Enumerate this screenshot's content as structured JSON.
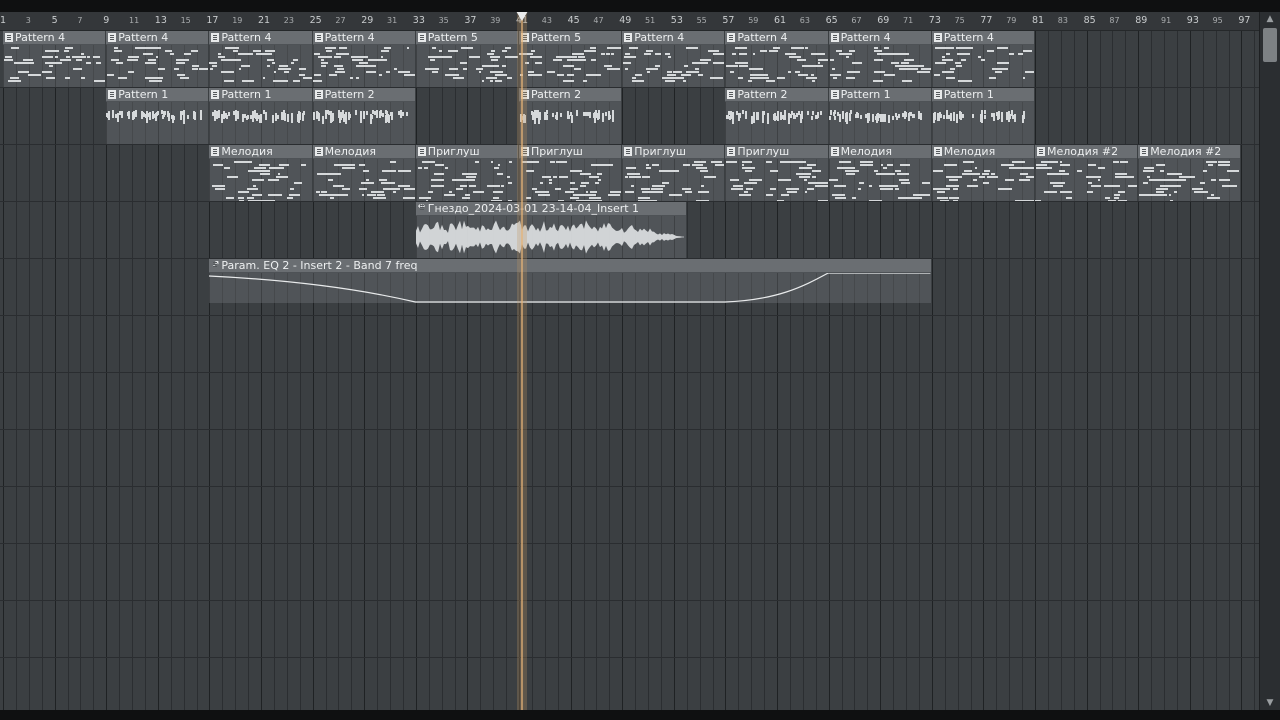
{
  "window": {
    "title": ""
  },
  "ruler": {
    "bars": [
      "1",
      "3",
      "5",
      "7",
      "9",
      "11",
      "13",
      "15",
      "17",
      "19",
      "21",
      "23",
      "25",
      "27",
      "29",
      "31",
      "33",
      "35",
      "37",
      "39",
      "41",
      "43",
      "45",
      "47",
      "49",
      "51",
      "53",
      "55",
      "57",
      "59",
      "61",
      "63",
      "65",
      "67",
      "69",
      "71",
      "73",
      "75",
      "77",
      "79",
      "81",
      "83",
      "85",
      "87",
      "89",
      "91",
      "93",
      "95",
      "97"
    ]
  },
  "playhead": {
    "bar": 41.2
  },
  "tracks": [
    {
      "name": "track-1",
      "clips": [
        {
          "label": "Pattern 4",
          "type": "pattern",
          "start": 1,
          "end": 9
        },
        {
          "label": "Pattern 4",
          "type": "pattern",
          "start": 9,
          "end": 17
        },
        {
          "label": "Pattern 4",
          "type": "pattern",
          "start": 17,
          "end": 25
        },
        {
          "label": "Pattern 4",
          "type": "pattern",
          "start": 25,
          "end": 33
        },
        {
          "label": "Pattern 5",
          "type": "pattern",
          "start": 33,
          "end": 41
        },
        {
          "label": "Pattern 5",
          "type": "pattern",
          "start": 41,
          "end": 49
        },
        {
          "label": "Pattern 4",
          "type": "pattern",
          "start": 49,
          "end": 57
        },
        {
          "label": "Pattern 4",
          "type": "pattern",
          "start": 57,
          "end": 65
        },
        {
          "label": "Pattern 4",
          "type": "pattern",
          "start": 65,
          "end": 73
        },
        {
          "label": "Pattern 4",
          "type": "pattern",
          "start": 73,
          "end": 81
        }
      ]
    },
    {
      "name": "track-2",
      "clips": [
        {
          "label": "Pattern 1",
          "type": "pattern",
          "start": 9,
          "end": 17
        },
        {
          "label": "Pattern 1",
          "type": "pattern",
          "start": 17,
          "end": 25
        },
        {
          "label": "Pattern 2",
          "type": "pattern",
          "start": 25,
          "end": 33
        },
        {
          "label": "Pattern 2",
          "type": "pattern",
          "start": 41,
          "end": 49
        },
        {
          "label": "Pattern 2",
          "type": "pattern",
          "start": 57,
          "end": 65
        },
        {
          "label": "Pattern 1",
          "type": "pattern",
          "start": 65,
          "end": 73
        },
        {
          "label": "Pattern 1",
          "type": "pattern",
          "start": 73,
          "end": 81
        }
      ]
    },
    {
      "name": "track-3",
      "clips": [
        {
          "label": "Мелодия",
          "type": "pattern",
          "start": 17,
          "end": 25
        },
        {
          "label": "Мелодия",
          "type": "pattern",
          "start": 25,
          "end": 33
        },
        {
          "label": "Приглуш",
          "type": "pattern",
          "start": 33,
          "end": 41
        },
        {
          "label": "Приглуш",
          "type": "pattern",
          "start": 41,
          "end": 49
        },
        {
          "label": "Приглуш",
          "type": "pattern",
          "start": 49,
          "end": 57
        },
        {
          "label": "Приглуш",
          "type": "pattern",
          "start": 57,
          "end": 65
        },
        {
          "label": "Мелодия",
          "type": "pattern",
          "start": 65,
          "end": 73
        },
        {
          "label": "Мелодия",
          "type": "pattern",
          "start": 73,
          "end": 81
        },
        {
          "label": "Мелодия #2",
          "type": "pattern",
          "start": 81,
          "end": 89
        },
        {
          "label": "Мелодия #2",
          "type": "pattern",
          "start": 89,
          "end": 97
        }
      ]
    },
    {
      "name": "track-4",
      "clips": [
        {
          "label": "Гнездо_2024-03-01 23-14-04_Insert 1",
          "type": "audio",
          "start": 33,
          "end": 54
        }
      ]
    },
    {
      "name": "track-5",
      "clips": [
        {
          "label": "Param. EQ 2 - Insert 2 - Band 7 freq",
          "type": "automation",
          "start": 17,
          "end": 73
        }
      ]
    },
    {
      "name": "track-6",
      "clips": []
    },
    {
      "name": "track-7",
      "clips": []
    },
    {
      "name": "track-8",
      "clips": []
    },
    {
      "name": "track-9",
      "clips": []
    },
    {
      "name": "track-10",
      "clips": []
    },
    {
      "name": "track-11",
      "clips": []
    },
    {
      "name": "track-12",
      "clips": []
    }
  ],
  "colors": {
    "background": "#3b3f42",
    "clip_header": "#6a6e72",
    "note": "#d6d9db",
    "playhead": "#e6b478"
  }
}
